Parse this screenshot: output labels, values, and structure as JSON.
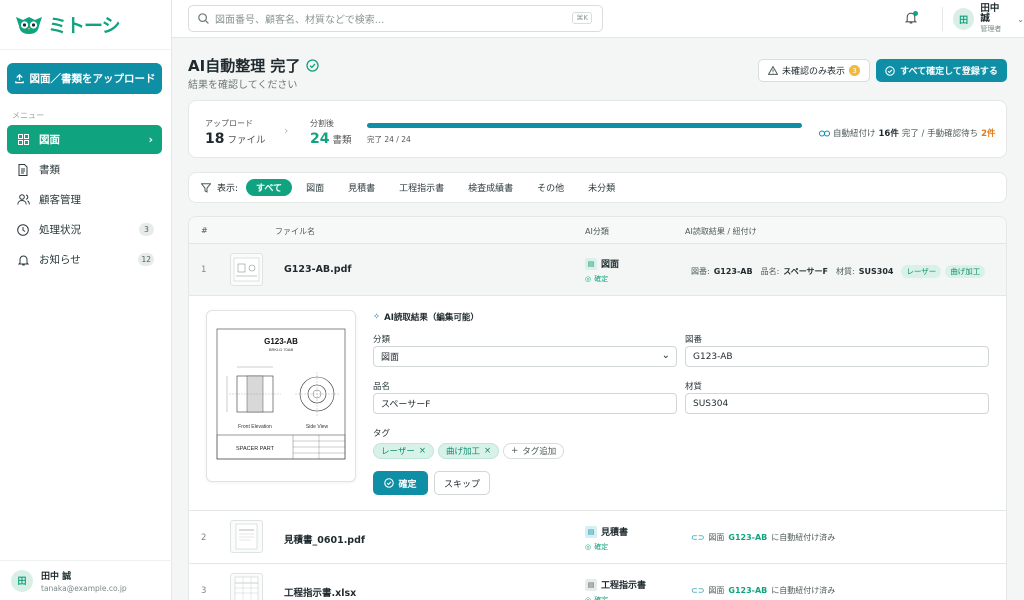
{
  "app": {
    "logo_text": "ミトーシ"
  },
  "sidebar": {
    "upload_label": "図面／書類をアップロード",
    "menu_label": "メニュー",
    "items": [
      {
        "label": "図面",
        "icon": "grid-icon",
        "active": true
      },
      {
        "label": "書類",
        "icon": "document-icon"
      },
      {
        "label": "顧客管理",
        "icon": "users-icon"
      },
      {
        "label": "処理状況",
        "icon": "clock-icon",
        "badge": "3"
      },
      {
        "label": "お知らせ",
        "icon": "bell-icon",
        "badge": "12"
      }
    ],
    "user": {
      "avatar": "田",
      "name": "田中 誠",
      "email": "tanaka@example.co.jp"
    }
  },
  "header": {
    "search_placeholder": "図面番号、顧客名、材質などで検索...",
    "shortcut": "⌘K",
    "user": {
      "avatar": "田",
      "name": "田中 誠",
      "role": "管理者"
    }
  },
  "page": {
    "title": "AI自動整理 完了",
    "subtitle": "結果を確認してください",
    "unconfirmed_label": "未確認のみ表示",
    "unconfirmed_count": "3",
    "confirm_all_label": "すべて確定して登録する"
  },
  "summary": {
    "upload_label": "アップロード",
    "upload_count": "18",
    "upload_unit": "ファイル",
    "split_label": "分割後",
    "split_count": "24",
    "split_unit": "書類",
    "progress_text": "完了 24 / 24",
    "progress_fraction": 1.0,
    "link_text_1": "自動紐付け",
    "link_count": "16件",
    "link_text_2": "完了 / 手動確認待ち",
    "manual_count": "2件"
  },
  "filters": {
    "label": "表示:",
    "chips": [
      "すべて",
      "図面",
      "見積書",
      "工程指示書",
      "検査成績書",
      "その他",
      "未分類"
    ]
  },
  "table": {
    "headers": {
      "num": "#",
      "file": "ファイル名",
      "ai": "AI分類",
      "result": "AI読取結果 / 紐付け"
    },
    "rows": [
      {
        "num": "1",
        "file": "G123-AB.pdf",
        "cls": "図面",
        "status": "確定",
        "r_drawing_label": "図番:",
        "r_drawing": "G123-AB",
        "r_name_label": "品名:",
        "r_name": "スペーサーF",
        "r_material_label": "材質:",
        "r_material": "SUS304",
        "tags": [
          "レーザー",
          "曲げ加工"
        ]
      },
      {
        "num": "2",
        "file": "見積書_0601.pdf",
        "cls": "見積書",
        "status": "確定",
        "link_prefix": "図面",
        "link_target": "G123-AB",
        "link_suffix": "に自動紐付け済み"
      },
      {
        "num": "3",
        "file": "工程指示書.xlsx",
        "cls": "工程指示書",
        "status": "確定",
        "link_prefix": "図面",
        "link_target": "G123-AB",
        "link_suffix": "に自動紐付け済み"
      }
    ]
  },
  "detail": {
    "form_title": "AI読取結果（編集可能）",
    "class_label": "分類",
    "class_value": "図面",
    "drawing_label": "図番",
    "drawing_value": "G123-AB",
    "name_label": "品名",
    "name_value": "スペーサーF",
    "material_label": "材質",
    "material_value": "SUS304",
    "tags_label": "タグ",
    "tags": [
      "レーザー",
      "曲げ加工"
    ],
    "add_tag_label": "タグ追加",
    "confirm_label": "確定",
    "skip_label": "スキップ",
    "drawing": {
      "title": "G123-AB",
      "subtitle": "BRKLD 70AB",
      "front_label": "Front Elevation",
      "side_label": "Side View",
      "part_label": "SPACER PART"
    }
  },
  "colors": {
    "brand": "#10a37f",
    "primary": "#0f8fa6",
    "warn": "#f3b93b"
  }
}
